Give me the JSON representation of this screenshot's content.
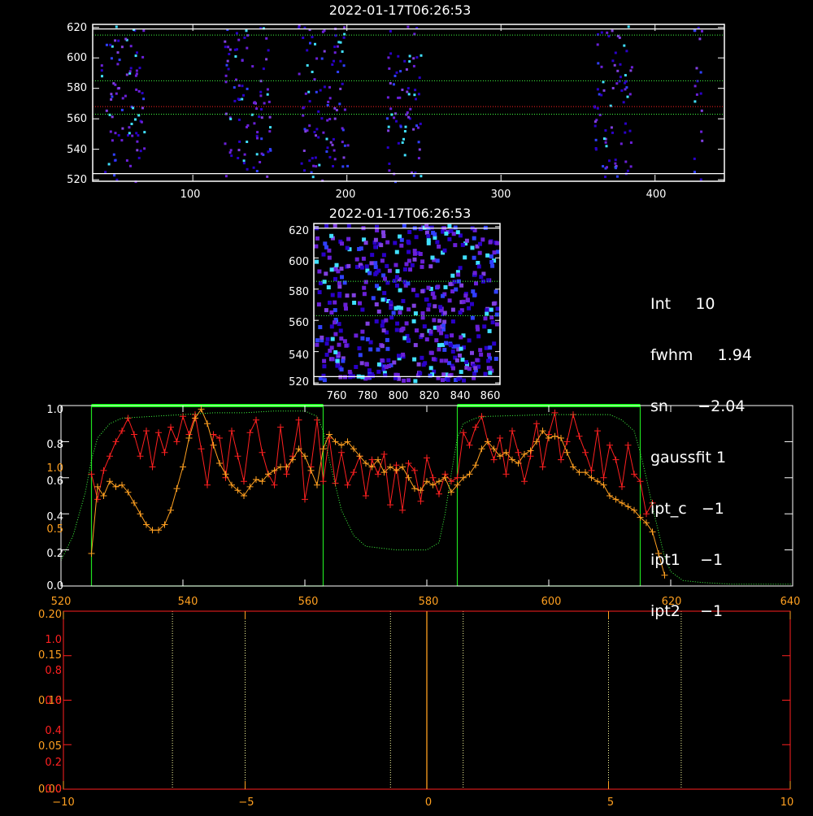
{
  "colors": {
    "background": "#000000",
    "axis": "#ffffff",
    "red_series": "#ff2020",
    "orange_series": "#ffa020",
    "green_box": "#20e020",
    "green_bar": "#00ff00",
    "dotted_green": "#40ff40",
    "dotted_red": "#ff2020",
    "pixel_dark": "#2a00c8",
    "pixel_purple": "#6a20d8",
    "pixel_cyan": "#40e0ff"
  },
  "top_image": {
    "title": "2022-01-17T06:26:53",
    "x_ticks": [
      "100",
      "200",
      "300",
      "400"
    ],
    "y_ticks": [
      "520",
      "540",
      "560",
      "580",
      "600",
      "620"
    ]
  },
  "mid_image": {
    "title": "2022-01-17T06:26:53",
    "x_ticks": [
      "760",
      "780",
      "800",
      "820",
      "840",
      "860"
    ],
    "y_ticks": [
      "520",
      "540",
      "560",
      "580",
      "600",
      "620"
    ]
  },
  "stats": [
    {
      "label": "Int",
      "value": "10"
    },
    {
      "label": "fwhm",
      "value": "1.94"
    },
    {
      "label": "sn",
      "value": "−2.04"
    },
    {
      "label": "gaussfit",
      "value": "1"
    },
    {
      "label": "ipt_c",
      "value": "−1"
    },
    {
      "label": "ipt1",
      "value": "−1"
    },
    {
      "label": "ipt2",
      "value": "−1"
    }
  ],
  "profile_plot": {
    "x_ticks": [
      "520",
      "540",
      "560",
      "580",
      "600",
      "620",
      "640"
    ],
    "y_ticks_white": [
      "0.0",
      "0.2",
      "0.4",
      "0.6",
      "0.8",
      "1.0"
    ],
    "y_ticks_orange": [
      "0.5",
      "1.0"
    ]
  },
  "bottom_plot": {
    "x_ticks": [
      "−10",
      "−5",
      "0",
      "5",
      "10"
    ],
    "y_ticks_a": [
      "0.00",
      "0.05",
      "0.10",
      "0.15",
      "0.20"
    ],
    "y_ticks_b": [
      "0.0",
      "0.2",
      "0.4",
      "0.6",
      "0.8",
      "1.0"
    ]
  },
  "chart_data": [
    {
      "type": "heatmap",
      "title": "2022-01-17T06:26:53",
      "xlim": [
        35,
        445
      ],
      "ylim": [
        519,
        622
      ],
      "bright_column_bands_x": [
        [
          40,
          68
        ],
        [
          120,
          150
        ],
        [
          168,
          200
        ],
        [
          225,
          248
        ],
        [
          360,
          385
        ],
        [
          424,
          430
        ]
      ],
      "hlines_solid_white_y": [
        524,
        619
      ],
      "hlines_dotted_green_y": [
        563,
        585,
        615
      ],
      "hline_dotted_red_y": 568
    },
    {
      "type": "heatmap",
      "title": "2022-01-17T06:26:53",
      "xlim": [
        745,
        865
      ],
      "ylim": [
        519,
        622
      ],
      "hlines_solid_white_y": [
        524,
        619
      ],
      "hlines_dotted_green_y": [
        563,
        585
      ]
    },
    {
      "type": "line",
      "xlim": [
        520,
        640
      ],
      "ylim": [
        0.0,
        1.0
      ],
      "box_regions_x": [
        [
          525,
          563
        ],
        [
          585,
          615
        ]
      ],
      "series": [
        {
          "color": "#ff2020",
          "x": [
            525,
            526,
            527,
            528,
            529,
            530,
            531,
            532,
            533,
            534,
            535,
            536,
            537,
            538,
            539,
            540,
            541,
            542,
            543,
            544,
            545,
            546,
            547,
            548,
            549,
            550,
            551,
            552,
            553,
            554,
            555,
            556,
            557,
            558,
            559,
            560,
            561,
            562,
            563,
            564,
            565,
            566,
            567,
            568,
            569,
            570,
            571,
            572,
            573,
            574,
            575,
            576,
            577,
            578,
            579,
            580,
            581,
            582,
            583,
            584,
            585,
            586,
            587,
            588,
            589,
            590,
            591,
            592,
            593,
            594,
            595,
            596,
            597,
            598,
            599,
            600,
            601,
            602,
            603,
            604,
            605,
            606,
            607,
            608,
            609,
            610,
            611,
            612,
            613,
            614,
            615,
            616,
            617
          ],
          "y": [
            0.62,
            0.48,
            0.64,
            0.72,
            0.8,
            0.86,
            0.93,
            0.84,
            0.72,
            0.86,
            0.66,
            0.85,
            0.74,
            0.88,
            0.8,
            0.94,
            0.84,
            0.95,
            0.76,
            0.56,
            0.84,
            0.82,
            0.6,
            0.86,
            0.72,
            0.58,
            0.85,
            0.92,
            0.74,
            0.62,
            0.56,
            0.88,
            0.62,
            0.72,
            0.92,
            0.48,
            0.66,
            0.92,
            0.58,
            0.82,
            0.57,
            0.74,
            0.56,
            0.63,
            0.72,
            0.5,
            0.7,
            0.62,
            0.73,
            0.45,
            0.67,
            0.42,
            0.68,
            0.64,
            0.47,
            0.71,
            0.6,
            0.51,
            0.62,
            0.58,
            0.6,
            0.85,
            0.78,
            0.88,
            0.94,
            0.8,
            0.7,
            0.82,
            0.62,
            0.86,
            0.74,
            0.58,
            0.72,
            0.9,
            0.66,
            0.84,
            0.96,
            0.7,
            0.8,
            0.95,
            0.83,
            0.74,
            0.64,
            0.86,
            0.6,
            0.78,
            0.7,
            0.55,
            0.78,
            0.62,
            0.58,
            0.4,
            0.46
          ]
        },
        {
          "color": "#ffa020",
          "x": [
            525,
            526,
            527,
            528,
            529,
            530,
            531,
            532,
            533,
            534,
            535,
            536,
            537,
            538,
            539,
            540,
            541,
            542,
            543,
            544,
            545,
            546,
            547,
            548,
            549,
            550,
            551,
            552,
            553,
            554,
            555,
            556,
            557,
            558,
            559,
            560,
            561,
            562,
            563,
            564,
            565,
            566,
            567,
            568,
            569,
            570,
            571,
            572,
            573,
            574,
            575,
            576,
            577,
            578,
            579,
            580,
            581,
            582,
            583,
            584,
            585,
            586,
            587,
            588,
            589,
            590,
            591,
            592,
            593,
            594,
            595,
            596,
            597,
            598,
            599,
            600,
            601,
            602,
            603,
            604,
            605,
            606,
            607,
            608,
            609,
            610,
            611,
            612,
            613,
            614,
            615,
            616,
            617,
            618,
            619
          ],
          "y": [
            0.18,
            0.55,
            0.5,
            0.58,
            0.55,
            0.56,
            0.52,
            0.46,
            0.4,
            0.34,
            0.31,
            0.31,
            0.34,
            0.42,
            0.54,
            0.66,
            0.82,
            0.93,
            0.98,
            0.9,
            0.78,
            0.68,
            0.62,
            0.56,
            0.53,
            0.5,
            0.55,
            0.59,
            0.58,
            0.62,
            0.64,
            0.66,
            0.66,
            0.7,
            0.76,
            0.72,
            0.64,
            0.56,
            0.76,
            0.84,
            0.8,
            0.78,
            0.8,
            0.76,
            0.72,
            0.68,
            0.66,
            0.7,
            0.63,
            0.66,
            0.64,
            0.66,
            0.6,
            0.54,
            0.53,
            0.58,
            0.56,
            0.58,
            0.6,
            0.52,
            0.56,
            0.6,
            0.62,
            0.67,
            0.76,
            0.8,
            0.76,
            0.72,
            0.74,
            0.7,
            0.68,
            0.73,
            0.75,
            0.8,
            0.86,
            0.82,
            0.83,
            0.82,
            0.74,
            0.66,
            0.63,
            0.63,
            0.6,
            0.58,
            0.56,
            0.5,
            0.48,
            0.46,
            0.44,
            0.42,
            0.38,
            0.35,
            0.3,
            0.18,
            0.06
          ]
        },
        {
          "color": "#40ff40",
          "style": "dotted",
          "x": [
            520,
            522,
            524,
            525,
            526,
            528,
            530,
            535,
            540,
            545,
            550,
            555,
            560,
            562,
            563,
            564,
            566,
            568,
            570,
            575,
            580,
            582,
            583,
            584,
            585,
            586,
            588,
            590,
            600,
            610,
            612,
            614,
            615,
            616,
            617,
            618,
            619,
            620,
            622,
            625,
            630,
            640
          ],
          "y": [
            0.14,
            0.28,
            0.52,
            0.7,
            0.82,
            0.9,
            0.93,
            0.94,
            0.95,
            0.96,
            0.96,
            0.97,
            0.97,
            0.94,
            0.86,
            0.7,
            0.42,
            0.28,
            0.22,
            0.2,
            0.2,
            0.24,
            0.4,
            0.62,
            0.82,
            0.9,
            0.93,
            0.94,
            0.95,
            0.95,
            0.92,
            0.86,
            0.74,
            0.6,
            0.44,
            0.3,
            0.16,
            0.08,
            0.03,
            0.02,
            0.01,
            0.01
          ]
        }
      ]
    },
    {
      "type": "line",
      "xlim": [
        -10,
        10
      ],
      "ylim": [
        0.0,
        0.2
      ],
      "vlines_dotted_x": [
        -7,
        -5,
        -1,
        1,
        5,
        7
      ],
      "vline_solid_orange_x": 0
    }
  ]
}
